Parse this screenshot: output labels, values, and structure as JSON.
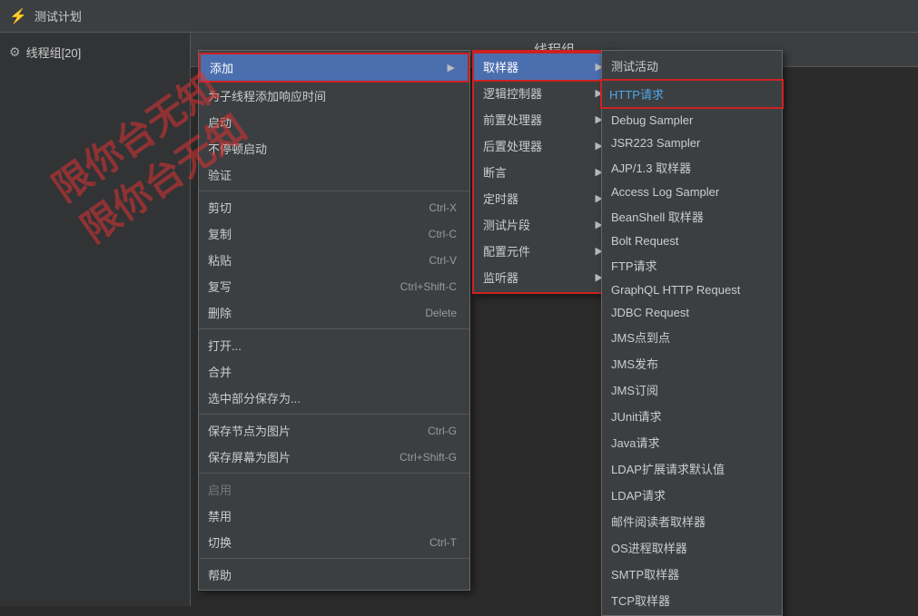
{
  "topbar": {
    "title": "测试计划"
  },
  "tree": {
    "items": [
      {
        "label": "线程组[20]",
        "icon": "⚙"
      }
    ]
  },
  "centerTitle": "线程组",
  "watermark": {
    "line1": "限你台无知",
    "line2": "限你台无知"
  },
  "menu1": {
    "title": "添加",
    "items": [
      {
        "label": "添加",
        "arrow": true,
        "active": true
      },
      {
        "label": "为子线程添加响应时间"
      },
      {
        "label": "启动"
      },
      {
        "label": "不停顿启动"
      },
      {
        "label": "验证"
      },
      {
        "sep": true
      },
      {
        "label": "剪切",
        "shortcut": "Ctrl-X"
      },
      {
        "label": "复制",
        "shortcut": "Ctrl-C"
      },
      {
        "label": "粘贴",
        "shortcut": "Ctrl-V"
      },
      {
        "label": "复写",
        "shortcut": "Ctrl+Shift-C"
      },
      {
        "label": "删除",
        "shortcut": "Delete"
      },
      {
        "sep": true
      },
      {
        "label": "打开..."
      },
      {
        "label": "合并"
      },
      {
        "label": "选中部分保存为..."
      },
      {
        "sep": true
      },
      {
        "label": "保存节点为图片",
        "shortcut": "Ctrl-G"
      },
      {
        "label": "保存屏幕为图片",
        "shortcut": "Ctrl+Shift-G"
      },
      {
        "sep": true
      },
      {
        "label": "启用",
        "disabled": true
      },
      {
        "label": "禁用"
      },
      {
        "label": "切换",
        "shortcut": "Ctrl-T"
      },
      {
        "sep": true
      },
      {
        "label": "帮助"
      }
    ]
  },
  "menu2": {
    "items": [
      {
        "label": "取样器",
        "arrow": true,
        "active": true
      },
      {
        "label": "逻辑控制器",
        "arrow": true
      },
      {
        "label": "前置处理器",
        "arrow": true
      },
      {
        "label": "后置处理器",
        "arrow": true
      },
      {
        "label": "断言",
        "arrow": true
      },
      {
        "label": "定时器",
        "arrow": true
      },
      {
        "label": "测试片段",
        "arrow": true
      },
      {
        "label": "配置元件",
        "arrow": true
      },
      {
        "label": "监听器",
        "arrow": true
      }
    ]
  },
  "menu3": {
    "items": [
      {
        "label": "测试活动"
      },
      {
        "label": "HTTP请求",
        "highlight": true
      },
      {
        "label": "Debug Sampler"
      },
      {
        "label": "JSR223 Sampler"
      },
      {
        "label": "AJP/1.3 取样器"
      },
      {
        "label": "Access Log Sampler"
      },
      {
        "label": "BeanShell 取样器"
      },
      {
        "label": "Bolt Request"
      },
      {
        "label": "FTP请求"
      },
      {
        "label": "GraphQL HTTP Request"
      },
      {
        "label": "JDBC Request"
      },
      {
        "label": "JMS点到点"
      },
      {
        "label": "JMS发布"
      },
      {
        "label": "JMS订阅"
      },
      {
        "label": "JUnit请求"
      },
      {
        "label": "Java请求"
      },
      {
        "label": "LDAP扩展请求默认值"
      },
      {
        "label": "LDAP请求"
      },
      {
        "label": "邮件阅读者取样器"
      },
      {
        "label": "OS进程取样器"
      },
      {
        "label": "SMTP取样器"
      },
      {
        "label": "TCP取样器"
      }
    ]
  }
}
